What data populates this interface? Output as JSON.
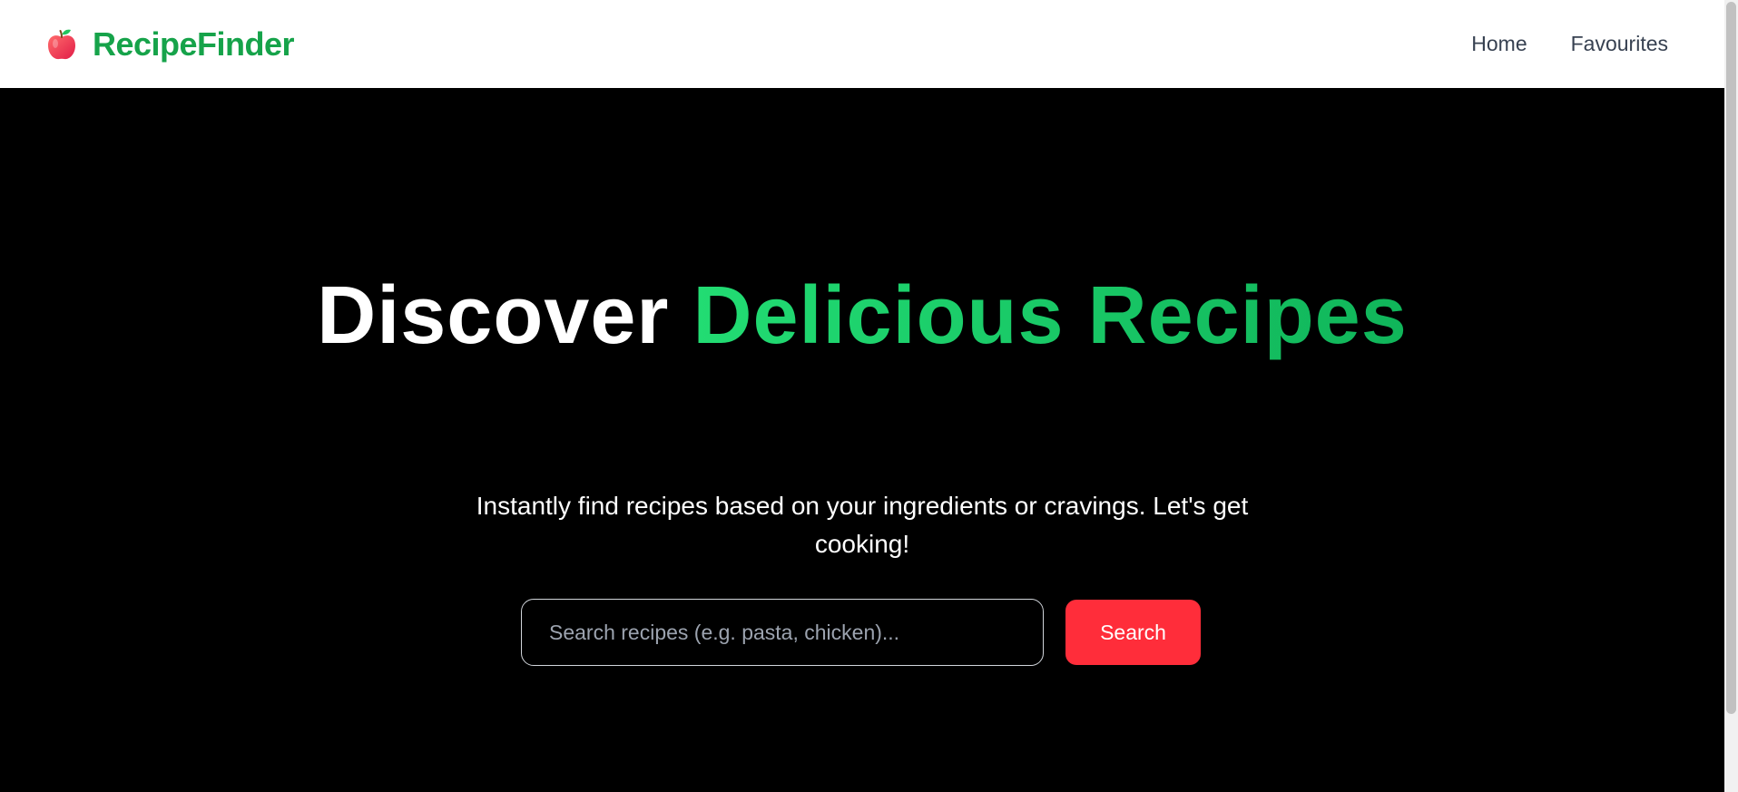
{
  "navbar": {
    "brand": {
      "icon": "apple-icon",
      "name": "RecipeFinder"
    },
    "links": [
      {
        "label": "Home"
      },
      {
        "label": "Favourites"
      }
    ]
  },
  "hero": {
    "title_plain": "Discover ",
    "title_accent": "Delicious Recipes",
    "subtitle": "Instantly find recipes based on your ingredients or cravings. Let's get cooking!",
    "search": {
      "placeholder": "Search recipes (e.g. pasta, chicken)...",
      "value": "",
      "button_label": "Search"
    }
  },
  "colors": {
    "brand_green": "#16a34a",
    "accent_green": "#10c45c",
    "search_button_red": "#ff2d3a",
    "hero_background": "#000000",
    "nav_text": "#374151"
  }
}
